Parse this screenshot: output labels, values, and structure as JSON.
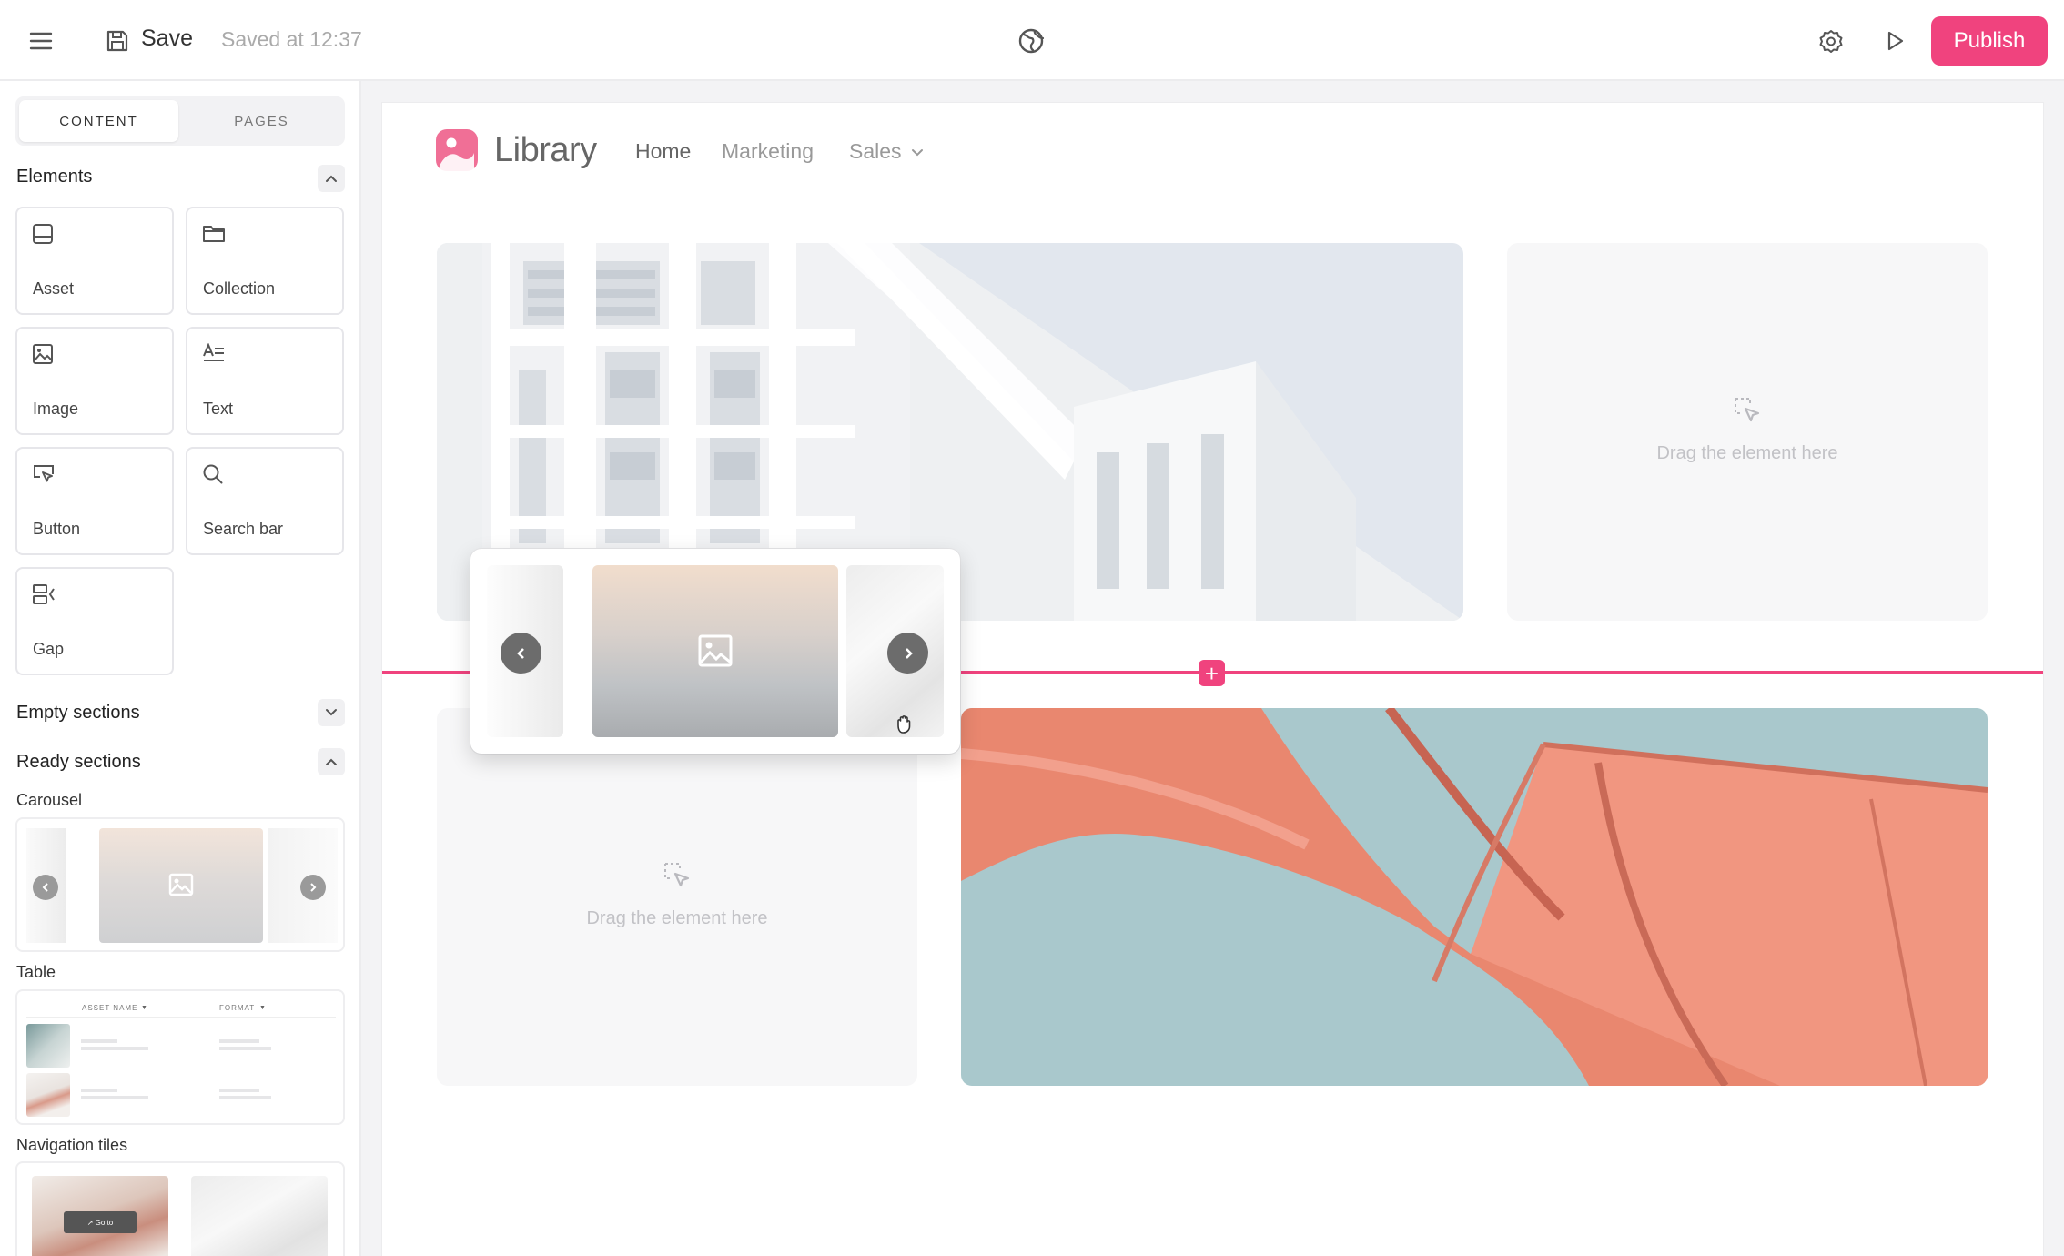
{
  "topbar": {
    "save_label": "Save",
    "saved_at": "Saved at 12:37",
    "publish_label": "Publish"
  },
  "sidebar": {
    "tabs": [
      {
        "label": "CONTENT",
        "active": true
      },
      {
        "label": "PAGES",
        "active": false
      }
    ],
    "elements_title": "Elements",
    "elements": [
      {
        "label": "Asset",
        "icon": "asset-icon"
      },
      {
        "label": "Collection",
        "icon": "folder-icon"
      },
      {
        "label": "Image",
        "icon": "image-icon"
      },
      {
        "label": "Text",
        "icon": "text-icon"
      },
      {
        "label": "Button",
        "icon": "button-cursor-icon"
      },
      {
        "label": "Search bar",
        "icon": "search-icon"
      },
      {
        "label": "Gap",
        "icon": "gap-icon"
      }
    ],
    "empty_sections_title": "Empty sections",
    "ready_sections_title": "Ready sections",
    "ready_sections": {
      "carousel_label": "Carousel",
      "table_label": "Table",
      "table_columns": [
        "ASSET NAME",
        "FORMAT"
      ],
      "navigation_tiles_label": "Navigation tiles",
      "go_to_label": "↗ Go to"
    }
  },
  "canvas": {
    "logo_text": "Library",
    "nav": [
      {
        "label": "Home"
      },
      {
        "label": "Marketing"
      },
      {
        "label": "Sales",
        "dropdown": true
      }
    ],
    "drop_text": "Drag the element here"
  },
  "colors": {
    "accent": "#f0437e",
    "hero_sky": "#e2e7ee",
    "sculpture": "#e9876f",
    "sculpture_sky": "#a9c8cc"
  }
}
